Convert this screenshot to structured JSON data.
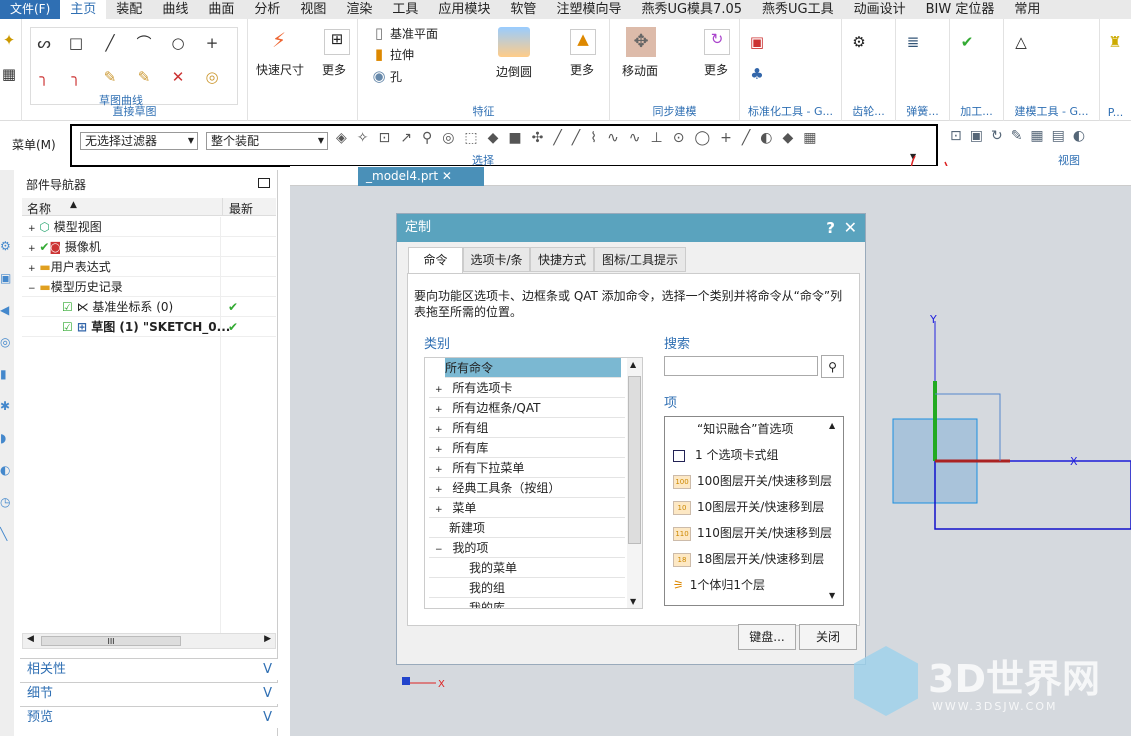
{
  "menubar": {
    "file": "文件(F)",
    "tabs": [
      "主页",
      "装配",
      "曲线",
      "曲面",
      "分析",
      "视图",
      "渲染",
      "工具",
      "应用模块",
      "软管",
      "注塑模向导",
      "燕秀UG模具7.05",
      "燕秀UG工具",
      "动画设计",
      "BIW 定位器",
      "常用"
    ]
  },
  "ribbon": {
    "groups": {
      "sketch_curves": "草图曲线",
      "direct_sketch": "直接草图",
      "feature": "特征",
      "sync": "同步建模",
      "std": "标准化工具 - G...",
      "gear": "齿轮...",
      "spring": "弹簧...",
      "machining": "加工...",
      "modeling": "建模工具 - G...",
      "p": "P..."
    },
    "buttons": {
      "quick_dim": "快速尺寸",
      "more1": "更多",
      "datum_plane": "基准平面",
      "extrude": "拉伸",
      "hole": "孔",
      "edge_blend": "边倒圆",
      "more2": "更多",
      "move_face": "移动面",
      "more3": "更多"
    }
  },
  "selbar": {
    "menu": "菜单(M)",
    "filter": "无选择过滤器",
    "scope": "整个装配",
    "label": "选择",
    "view_label": "视图"
  },
  "doc_tab": {
    "name": "_model4.prt"
  },
  "navigator": {
    "title": "部件导航器",
    "col_name": "名称",
    "col_latest": "最新",
    "items": [
      {
        "label": "模型视图"
      },
      {
        "label": "摄像机"
      },
      {
        "label": "用户表达式"
      },
      {
        "label": "模型历史记录"
      },
      {
        "label": "基准坐标系 (0)"
      },
      {
        "label": "草图 (1) \"SKETCH_0..."
      }
    ],
    "accordion": [
      "相关性",
      "细节",
      "预览"
    ],
    "scroll_grip": "III"
  },
  "dialog": {
    "title": "定制",
    "tabs": [
      "命令",
      "选项卡/条",
      "快捷方式",
      "图标/工具提示"
    ],
    "description": "要向功能区选项卡、边框条或 QAT 添加命令，选择一个类别并将命令从“命令”列表拖至所需的位置。",
    "category_label": "类别",
    "categories": [
      "所有命令",
      "所有选项卡",
      "所有边框条/QAT",
      "所有组",
      "所有库",
      "所有下拉菜单",
      "经典工具条（按组）",
      "菜单",
      "新建项",
      "我的项",
      "我的菜单",
      "我的组",
      "我的库"
    ],
    "search_label": "搜索",
    "search_value": "",
    "items_label": "项",
    "items": [
      {
        "icon": "",
        "label": "“知识融合”首选项"
      },
      {
        "icon": "",
        "label": "1 个选项卡式组"
      },
      {
        "icon": "100",
        "label": "100图层开关/快速移到层"
      },
      {
        "icon": "10",
        "label": "10图层开关/快速移到层"
      },
      {
        "icon": "110",
        "label": "110图层开关/快速移到层"
      },
      {
        "icon": "18",
        "label": "18图层开关/快速移到层"
      },
      {
        "icon": "",
        "label": "1个体归1个层"
      }
    ],
    "keyboard_btn": "键盘...",
    "close_btn": "关闭"
  },
  "axes": {
    "y": "Y",
    "x": "X"
  },
  "watermark": {
    "text": "3D世界网",
    "url": "WWW.3DSJW.COM"
  }
}
